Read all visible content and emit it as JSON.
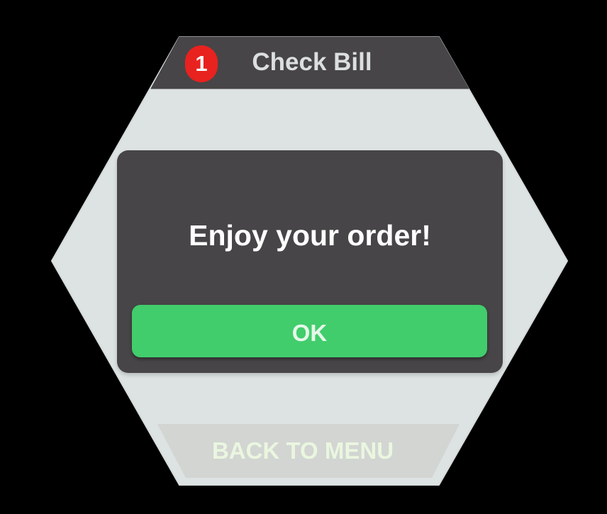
{
  "header": {
    "title": "Check Bill",
    "badge_count": "1"
  },
  "dialog": {
    "message": "Enjoy your order!",
    "ok_label": "OK"
  },
  "footer": {
    "back_label": "BACK TO MENU"
  },
  "colors": {
    "background": "#000000",
    "hex_panel": "#dde2e2",
    "header_bar": "#474547",
    "dialog": "#474547",
    "ok_button": "#41cd6c",
    "badge": "#e8221f",
    "back_button": "#d2d5d2"
  }
}
